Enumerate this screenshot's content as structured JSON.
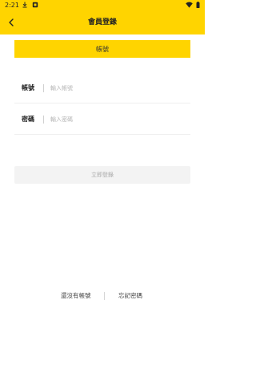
{
  "status_bar": {
    "time": "2:21",
    "left_icons": [
      "download-icon",
      "notification-box-icon"
    ],
    "right_icons": [
      "wifi-icon",
      "battery-icon"
    ]
  },
  "header": {
    "title": "會員登錄",
    "back_icon": "chevron-left-icon",
    "background_color": "#ffd400"
  },
  "tab": {
    "label": "帳號"
  },
  "form": {
    "account": {
      "label": "帳號",
      "placeholder": "輸入帳號",
      "value": ""
    },
    "password": {
      "label": "密碼",
      "placeholder": "輸入密碼",
      "value": ""
    }
  },
  "login_button": {
    "label": "立即登錄",
    "background_color": "#f3f3f3"
  },
  "links": {
    "register": "還沒有帳號",
    "forgot_password": "忘記密碼"
  }
}
